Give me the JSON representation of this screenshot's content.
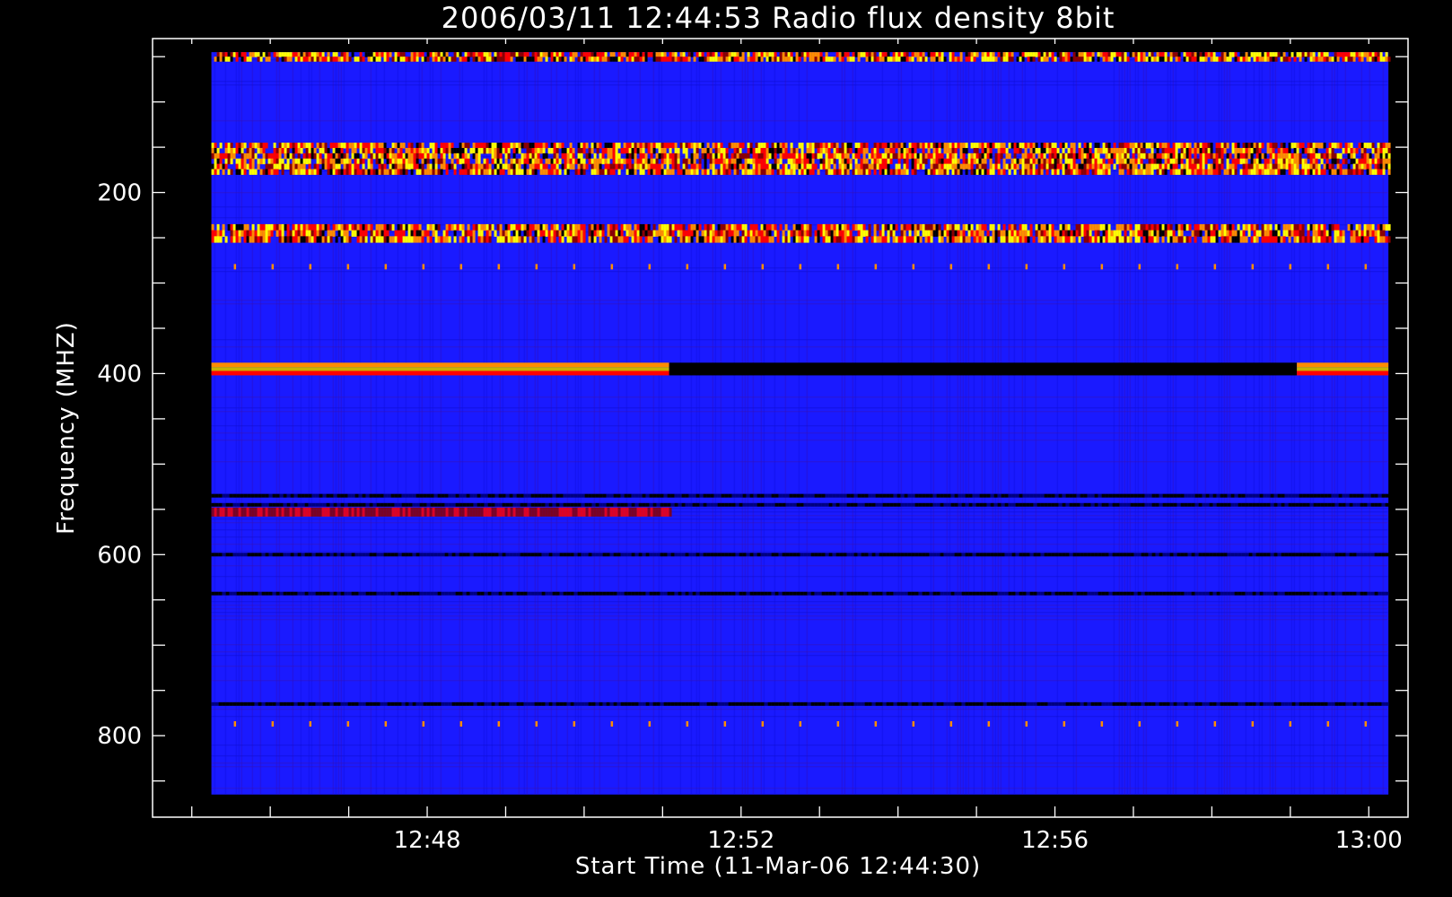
{
  "chart_data": {
    "type": "heatmap",
    "title": "2006/03/11 12:44:53 Radio flux density 8bit",
    "xlabel": "Start Time (11-Mar-06 12:44:30)",
    "ylabel": "Frequency (MHZ)",
    "x_range_minutes": [
      "12:44:30",
      "13:00:30"
    ],
    "y_range_mhz": [
      30,
      890
    ],
    "y_inverted": true,
    "x_ticks": [
      "12:48",
      "12:52",
      "12:56",
      "13:00"
    ],
    "y_ticks": [
      "200",
      "400",
      "600",
      "800"
    ],
    "data_x_range": [
      "12:45:15",
      "13:00:15"
    ],
    "data_y_range_mhz": [
      45,
      865
    ],
    "colormap": [
      "#000000",
      "#000080",
      "#1a1aff",
      "#2222ee",
      "#8b0000",
      "#ff0000",
      "#ff8c00",
      "#ffff00"
    ],
    "background_color": "#1a1aff",
    "features": [
      {
        "type": "intermittent_band",
        "freq_mhz": [
          45,
          55
        ],
        "intensity": "high"
      },
      {
        "type": "intermittent_band",
        "freq_mhz": [
          145,
          180
        ],
        "intensity": "high"
      },
      {
        "type": "intermittent_band",
        "freq_mhz": [
          235,
          255
        ],
        "intensity": "high"
      },
      {
        "type": "dot_row",
        "freq_mhz": 282
      },
      {
        "type": "dot_row",
        "freq_mhz": 787
      },
      {
        "type": "steady_band",
        "freq_mhz": [
          388,
          402
        ],
        "time": [
          "12:45:15",
          "12:51:05"
        ],
        "intensity": "high"
      },
      {
        "type": "steady_band",
        "freq_mhz": [
          388,
          402
        ],
        "time": [
          "12:51:05",
          "12:59:05"
        ],
        "intensity": "low"
      },
      {
        "type": "steady_band",
        "freq_mhz": [
          388,
          402
        ],
        "time": [
          "12:59:05",
          "13:00:15"
        ],
        "intensity": "high"
      },
      {
        "type": "dark_line",
        "freq_mhz": 535
      },
      {
        "type": "dark_line",
        "freq_mhz": 545
      },
      {
        "type": "dark_line",
        "freq_mhz": 600
      },
      {
        "type": "dark_line",
        "freq_mhz": 643
      },
      {
        "type": "dark_line",
        "freq_mhz": 765
      },
      {
        "type": "red_band",
        "freq_mhz": [
          548,
          558
        ],
        "time": [
          "12:45:15",
          "12:51:05"
        ]
      }
    ]
  }
}
